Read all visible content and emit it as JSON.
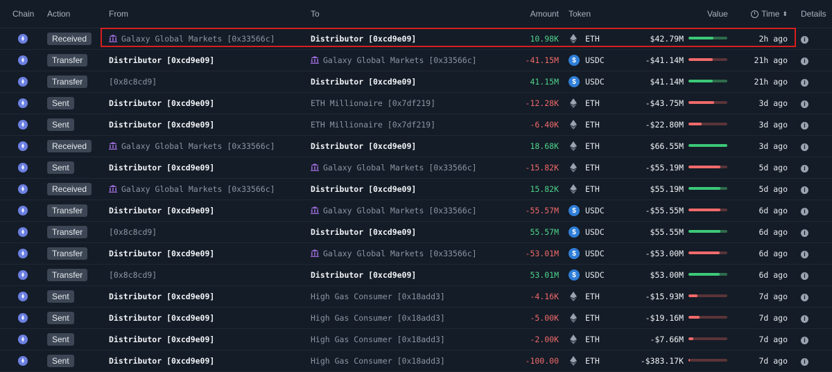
{
  "headers": {
    "chain": "Chain",
    "action": "Action",
    "from": "From",
    "to": "To",
    "amount": "Amount",
    "token": "Token",
    "value": "Value",
    "time": "Time",
    "details": "Details"
  },
  "colors": {
    "positive": "#4fd38a",
    "negative": "#f06a6a",
    "highlight": "#d81e1e",
    "usdc": "#2f7ed8"
  },
  "rows": [
    {
      "action": "Received",
      "from": "Galaxy Global Markets [0x33566c]",
      "from_bank": true,
      "from_bold": false,
      "to": "Distributor [0xcd9e09]",
      "to_bank": false,
      "to_bold": true,
      "amount": "10.98K",
      "sign": "pos",
      "token": "ETH",
      "value": "$42.79M",
      "bar": 0.65,
      "time": "2h ago"
    },
    {
      "action": "Transfer",
      "from": "Distributor [0xcd9e09]",
      "from_bank": false,
      "from_bold": true,
      "to": "Galaxy Global Markets [0x33566c]",
      "to_bank": true,
      "to_bold": false,
      "amount": "-41.15M",
      "sign": "neg",
      "token": "USDC",
      "value": "-$41.14M",
      "bar": 0.62,
      "time": "21h ago"
    },
    {
      "action": "Transfer",
      "from": "[0x8c8cd9]",
      "from_bank": false,
      "from_bold": false,
      "to": "Distributor [0xcd9e09]",
      "to_bank": false,
      "to_bold": true,
      "amount": "41.15M",
      "sign": "pos",
      "token": "USDC",
      "value": "$41.14M",
      "bar": 0.62,
      "time": "21h ago"
    },
    {
      "action": "Sent",
      "from": "Distributor [0xcd9e09]",
      "from_bank": false,
      "from_bold": true,
      "to": "ETH Millionaire [0x7df219]",
      "to_bank": false,
      "to_bold": false,
      "amount": "-12.28K",
      "sign": "neg",
      "token": "ETH",
      "value": "-$43.75M",
      "bar": 0.66,
      "time": "3d ago"
    },
    {
      "action": "Sent",
      "from": "Distributor [0xcd9e09]",
      "from_bank": false,
      "from_bold": true,
      "to": "ETH Millionaire [0x7df219]",
      "to_bank": false,
      "to_bold": false,
      "amount": "-6.40K",
      "sign": "neg",
      "token": "ETH",
      "value": "-$22.80M",
      "bar": 0.34,
      "time": "3d ago"
    },
    {
      "action": "Received",
      "from": "Galaxy Global Markets [0x33566c]",
      "from_bank": true,
      "from_bold": false,
      "to": "Distributor [0xcd9e09]",
      "to_bank": false,
      "to_bold": true,
      "amount": "18.68K",
      "sign": "pos",
      "token": "ETH",
      "value": "$66.55M",
      "bar": 1.0,
      "time": "3d ago"
    },
    {
      "action": "Sent",
      "from": "Distributor [0xcd9e09]",
      "from_bank": false,
      "from_bold": true,
      "to": "Galaxy Global Markets [0x33566c]",
      "to_bank": true,
      "to_bold": false,
      "amount": "-15.82K",
      "sign": "neg",
      "token": "ETH",
      "value": "-$55.19M",
      "bar": 0.83,
      "time": "5d ago"
    },
    {
      "action": "Received",
      "from": "Galaxy Global Markets [0x33566c]",
      "from_bank": true,
      "from_bold": false,
      "to": "Distributor [0xcd9e09]",
      "to_bank": false,
      "to_bold": true,
      "amount": "15.82K",
      "sign": "pos",
      "token": "ETH",
      "value": "$55.19M",
      "bar": 0.83,
      "time": "5d ago"
    },
    {
      "action": "Transfer",
      "from": "Distributor [0xcd9e09]",
      "from_bank": false,
      "from_bold": true,
      "to": "Galaxy Global Markets [0x33566c]",
      "to_bank": true,
      "to_bold": false,
      "amount": "-55.57M",
      "sign": "neg",
      "token": "USDC",
      "value": "-$55.55M",
      "bar": 0.83,
      "time": "6d ago"
    },
    {
      "action": "Transfer",
      "from": "[0x8c8cd9]",
      "from_bank": false,
      "from_bold": false,
      "to": "Distributor [0xcd9e09]",
      "to_bank": false,
      "to_bold": true,
      "amount": "55.57M",
      "sign": "pos",
      "token": "USDC",
      "value": "$55.55M",
      "bar": 0.83,
      "time": "6d ago"
    },
    {
      "action": "Transfer",
      "from": "Distributor [0xcd9e09]",
      "from_bank": false,
      "from_bold": true,
      "to": "Galaxy Global Markets [0x33566c]",
      "to_bank": true,
      "to_bold": false,
      "amount": "-53.01M",
      "sign": "neg",
      "token": "USDC",
      "value": "-$53.00M",
      "bar": 0.8,
      "time": "6d ago"
    },
    {
      "action": "Transfer",
      "from": "[0x8c8cd9]",
      "from_bank": false,
      "from_bold": false,
      "to": "Distributor [0xcd9e09]",
      "to_bank": false,
      "to_bold": true,
      "amount": "53.01M",
      "sign": "pos",
      "token": "USDC",
      "value": "$53.00M",
      "bar": 0.8,
      "time": "6d ago"
    },
    {
      "action": "Sent",
      "from": "Distributor [0xcd9e09]",
      "from_bank": false,
      "from_bold": true,
      "to": "High Gas Consumer [0x18add3]",
      "to_bank": false,
      "to_bold": false,
      "amount": "-4.16K",
      "sign": "neg",
      "token": "ETH",
      "value": "-$15.93M",
      "bar": 0.24,
      "time": "7d ago"
    },
    {
      "action": "Sent",
      "from": "Distributor [0xcd9e09]",
      "from_bank": false,
      "from_bold": true,
      "to": "High Gas Consumer [0x18add3]",
      "to_bank": false,
      "to_bold": false,
      "amount": "-5.00K",
      "sign": "neg",
      "token": "ETH",
      "value": "-$19.16M",
      "bar": 0.29,
      "time": "7d ago"
    },
    {
      "action": "Sent",
      "from": "Distributor [0xcd9e09]",
      "from_bank": false,
      "from_bold": true,
      "to": "High Gas Consumer [0x18add3]",
      "to_bank": false,
      "to_bold": false,
      "amount": "-2.00K",
      "sign": "neg",
      "token": "ETH",
      "value": "-$7.66M",
      "bar": 0.12,
      "time": "7d ago"
    },
    {
      "action": "Sent",
      "from": "Distributor [0xcd9e09]",
      "from_bank": false,
      "from_bold": true,
      "to": "High Gas Consumer [0x18add3]",
      "to_bank": false,
      "to_bold": false,
      "amount": "-100.00",
      "sign": "neg",
      "token": "ETH",
      "value": "-$383.17K",
      "bar": 0.02,
      "time": "7d ago"
    }
  ]
}
